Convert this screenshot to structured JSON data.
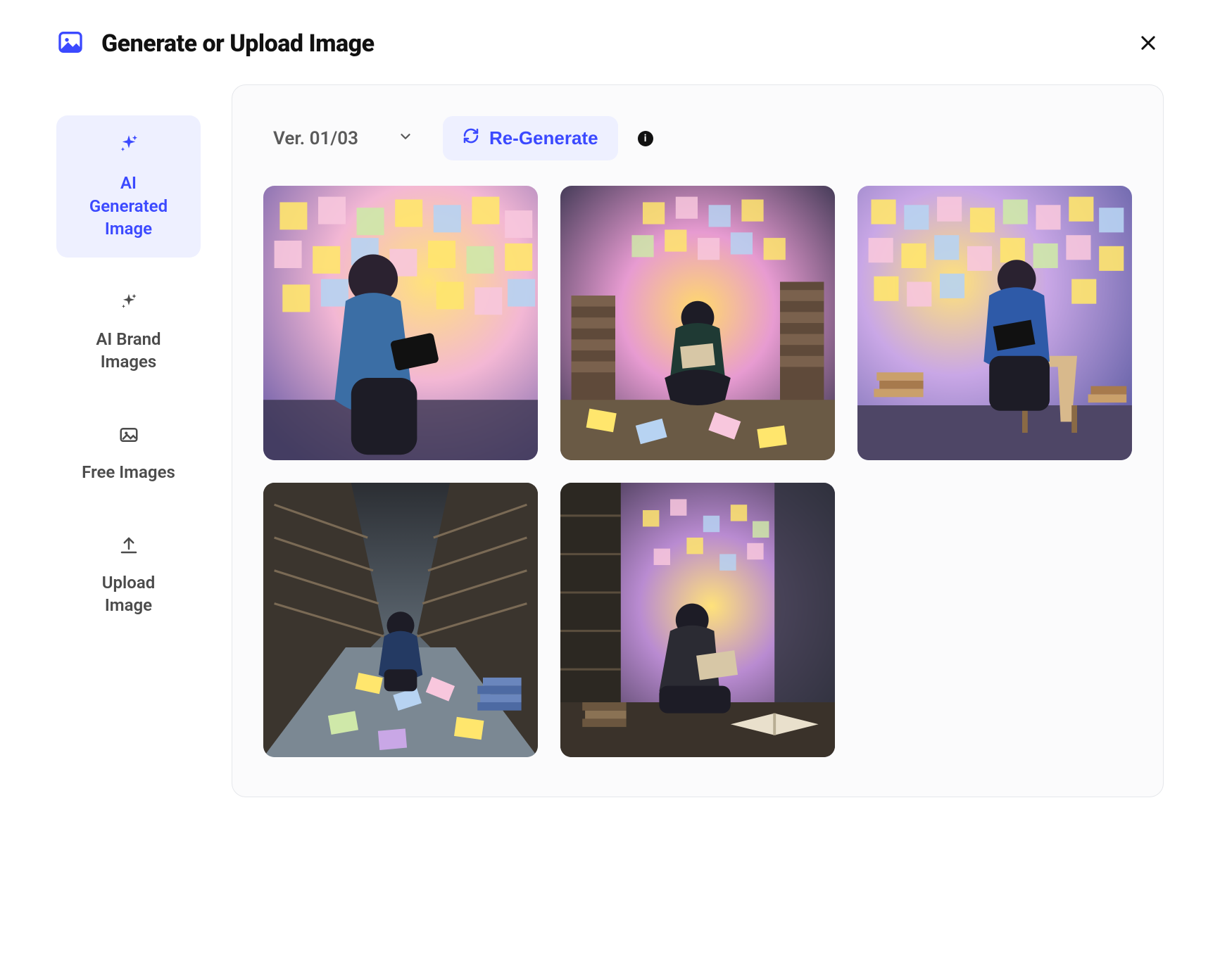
{
  "header": {
    "title": "Generate or Upload Image"
  },
  "sidebar": {
    "items": [
      {
        "name": "ai-generated-image",
        "label": "AI\nGenerated\nImage",
        "icon": "sparkles",
        "active": true
      },
      {
        "name": "ai-brand-images",
        "label": "AI Brand\nImages",
        "icon": "sparkles",
        "active": false
      },
      {
        "name": "free-images",
        "label": "Free Images",
        "icon": "image",
        "active": false
      },
      {
        "name": "upload-image",
        "label": "Upload\nImage",
        "icon": "upload",
        "active": false
      }
    ]
  },
  "toolbar": {
    "version_label": "Ver. 01/03",
    "regenerate_label": "Re-Generate"
  },
  "images": {
    "count": 5,
    "alt": [
      "Person with glasses reading a tablet, surrounded by walls covered in pastel sticky notes",
      "Person sitting cross-legged reading a book amid stacks of books and a wall of colorful notes with warm glow",
      "Person seated on a chair reading, wall behind covered with multicolored sticky notes",
      "Person sitting on the floor of a library aisle, floor covered with colorful papers",
      "Person reading in a dim room with bookshelves and glowing floating notes, stacks of books on the floor"
    ]
  },
  "colors": {
    "accent": "#3b49ff",
    "accent_light": "#eef0ff",
    "panel": "#fbfbfc",
    "border": "#e5e7eb"
  }
}
